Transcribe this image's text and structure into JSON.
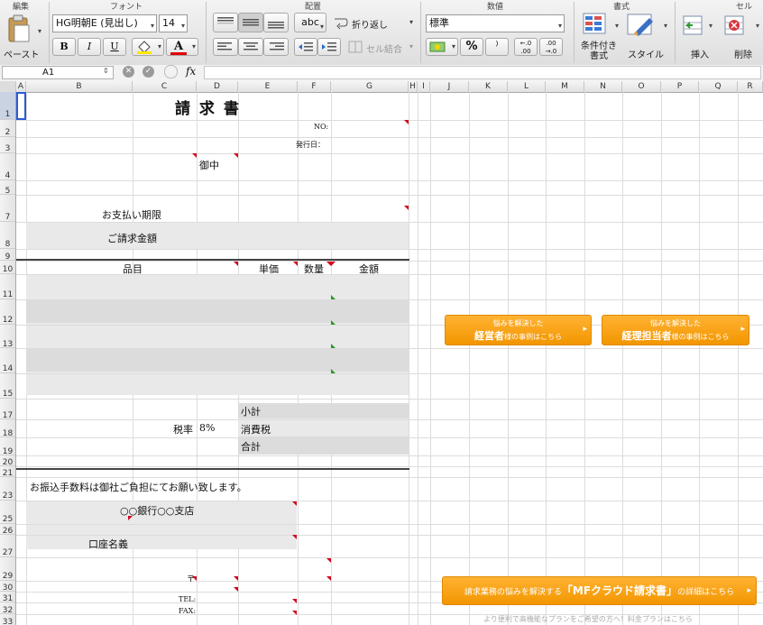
{
  "ribbon": {
    "groups": {
      "edit": "編集",
      "font": "フォント",
      "align": "配置",
      "number": "数値",
      "style": "書式",
      "cells": "セル"
    },
    "paste_label": "ペースト",
    "font_name": "HG明朝E (見出し)",
    "font_size": "14",
    "bold": "B",
    "italic": "I",
    "underline": "U",
    "font_color_glyph": "A",
    "abc_label": "abc",
    "wrap_label": "折り返し",
    "merge_label": "セル結合",
    "number_format": "標準",
    "percent": "%",
    "comma": "⁾",
    "dec_inc": "←.0 .00",
    "dec_dec": ".00 →.0",
    "conditional_label": "条件付き\n書式",
    "style_label": "スタイル",
    "insert_label": "挿入",
    "delete_label": "削除"
  },
  "formula_bar": {
    "cell_ref": "A1",
    "fx": "fx",
    "content": ""
  },
  "columns": [
    "A",
    "B",
    "C",
    "D",
    "E",
    "F",
    "G",
    "H",
    "I",
    "J",
    "K",
    "L",
    "M",
    "N",
    "O",
    "P",
    "Q",
    "R"
  ],
  "rows": [
    "1",
    "2",
    "3",
    "4",
    "5",
    "7",
    "8",
    "9",
    "10",
    "11",
    "12",
    "13",
    "14",
    "15",
    "17",
    "18",
    "19",
    "20",
    "21",
    "23",
    "25",
    "26",
    "27",
    "29",
    "30",
    "31",
    "32",
    "33"
  ],
  "sheet": {
    "title": "請 求 書",
    "no_label": "NO:",
    "issue_label": "発行日：",
    "onchu": "御中",
    "due_label": "お支払い期限",
    "amount_label": "ご請求金額",
    "col_item": "品目",
    "col_unit": "単価",
    "col_qty": "数量",
    "col_amount": "金額",
    "tax_rate_label": "税率",
    "tax_rate": "8%",
    "subtotal": "小計",
    "tax": "消費税",
    "total": "合計",
    "fee_note": "お振込手数料は御社ご負担にてお願い致します。",
    "bank": "○○銀行○○支店",
    "account_name": "口座名義",
    "postal": "〒",
    "tel": "TEL:",
    "fax": "FAX:"
  },
  "ads": {
    "btn1_line1": "悩みを解決した",
    "btn1_strong": "経営者",
    "btn1_rest": "様の事例はこちら",
    "btn2_line1": "悩みを解決した",
    "btn2_strong": "経理担当者",
    "btn2_rest": "様の事例はこちら",
    "btn3_pre": "請求業務の悩みを解決する",
    "btn3_strong": "「MFクラウド請求書」",
    "btn3_post": "の詳細はこちら",
    "footer_note": "より便利で高機能なプランをご希望の方へ！料金プランはこちら"
  },
  "colors": {
    "accent": "#f29600",
    "red_marker": "#d0021b",
    "green_marker": "#2a9a2a"
  }
}
